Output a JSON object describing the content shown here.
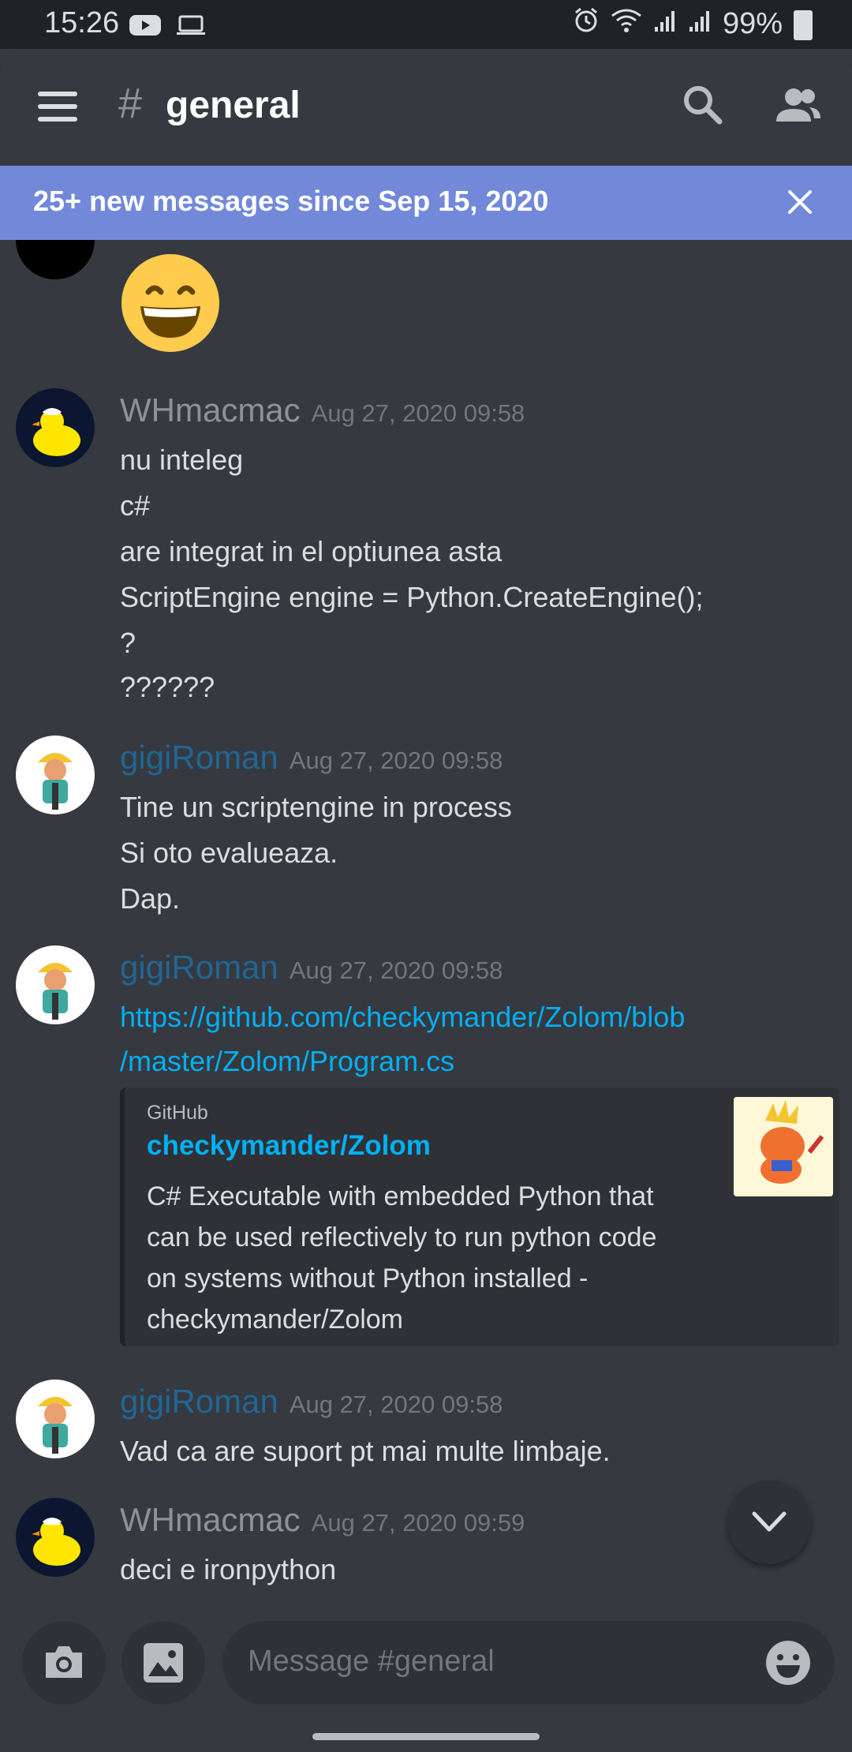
{
  "status_bar": {
    "time": "15:26",
    "battery": "99%",
    "icons": [
      "youtube-icon",
      "laptop-icon",
      "alarm-icon",
      "wifi-icon",
      "signal-icon",
      "signal-icon",
      "battery-icon"
    ]
  },
  "header": {
    "hash": "#",
    "channel": "general"
  },
  "banner": {
    "text": "25+ new messages since Sep 15, 2020"
  },
  "messages": [
    {
      "author": "WHmacmac",
      "timestamp": "Aug 27, 2020 09:58",
      "lines": [
        "nu inteleg",
        "c#",
        "are integrat in el optiunea asta",
        "ScriptEngine engine = Python.CreateEngine();",
        "?",
        "??????"
      ]
    },
    {
      "author": "gigiRoman",
      "timestamp": "Aug 27, 2020 09:58",
      "lines": [
        "Tine un scriptengine in process",
        "Si oto evalueaza.",
        "Dap."
      ]
    },
    {
      "author": "gigiRoman",
      "timestamp": "Aug 27, 2020 09:58",
      "link_lines": [
        "https://github.com/checkymander/Zolom/blob",
        "/master/Zolom/Program.cs"
      ],
      "embed": {
        "provider": "GitHub",
        "title": "checkymander/Zolom",
        "description_lines": [
          "C# Executable with embedded Python that",
          "can be used reflectively to run python code",
          "on systems without Python installed -",
          "checkymander/Zolom"
        ]
      }
    },
    {
      "author": "gigiRoman",
      "timestamp": "Aug 27, 2020 09:58",
      "lines": [
        "Vad ca are suport pt mai multe limbaje."
      ]
    },
    {
      "author": "WHmacmac",
      "timestamp": "Aug 27, 2020 09:59",
      "lines": [
        "deci e ironpython"
      ]
    }
  ],
  "author_colors": {
    "WHmacmac": "#8e9297",
    "gigiRoman": "#206694"
  },
  "input": {
    "placeholder": "Message #general"
  }
}
